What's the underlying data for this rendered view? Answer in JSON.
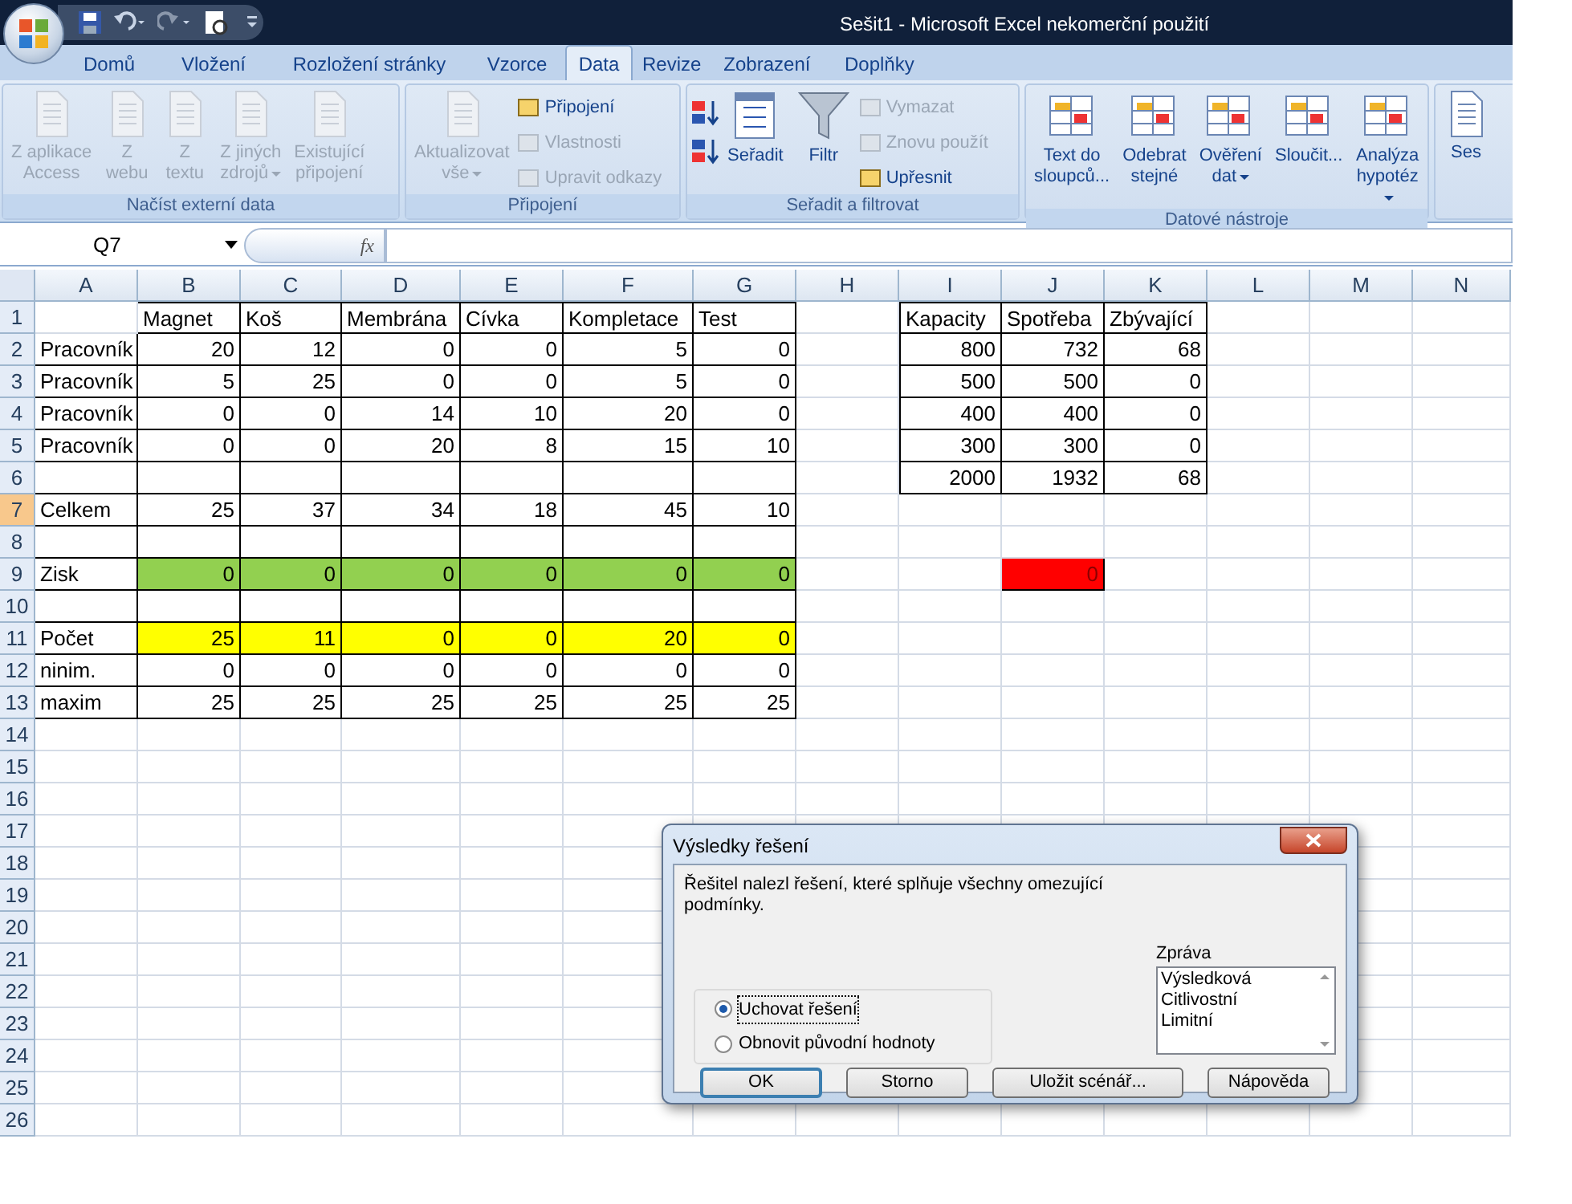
{
  "window": {
    "title": "Sešit1 - Microsoft Excel nekomerční použití"
  },
  "tabs": [
    {
      "label": "Domů",
      "selected": false
    },
    {
      "label": "Vložení",
      "selected": false
    },
    {
      "label": "Rozložení stránky",
      "selected": false
    },
    {
      "label": "Vzorce",
      "selected": false
    },
    {
      "label": "Data",
      "selected": true
    },
    {
      "label": "Revize",
      "selected": false
    },
    {
      "label": "Zobrazení",
      "selected": false
    },
    {
      "label": "Doplňky",
      "selected": false
    }
  ],
  "ribbon_groups": [
    {
      "label": "Načíst externí data",
      "items": [
        {
          "kind": "large",
          "label": "Z aplikace\nAccess",
          "disabled": true
        },
        {
          "kind": "large",
          "label": "Z\nwebu",
          "disabled": true
        },
        {
          "kind": "large",
          "label": "Z\ntextu",
          "disabled": true
        },
        {
          "kind": "large",
          "label": "Z jiných\nzdrojů",
          "dropdown": true,
          "disabled": true
        },
        {
          "kind": "large",
          "label": "Existující\npřipojení",
          "disabled": true
        }
      ]
    },
    {
      "label": "Připojení",
      "items": [
        {
          "kind": "large",
          "label": "Aktualizovat\nvše",
          "dropdown": true,
          "disabled": true
        },
        {
          "kind": "small",
          "label": "Připojení",
          "disabled": false
        },
        {
          "kind": "small",
          "label": "Vlastnosti",
          "disabled": true
        },
        {
          "kind": "small",
          "label": "Upravit odkazy",
          "disabled": true
        }
      ]
    },
    {
      "label": "Seřadit a filtrovat",
      "items": [
        {
          "kind": "sort",
          "label": "Seřadit",
          "disabled": false
        },
        {
          "kind": "large",
          "label": "Filtr",
          "disabled": false
        },
        {
          "kind": "small",
          "label": "Vymazat",
          "disabled": true
        },
        {
          "kind": "small",
          "label": "Znovu použít",
          "disabled": true
        },
        {
          "kind": "small",
          "label": "Upřesnit",
          "disabled": false
        }
      ]
    },
    {
      "label": "Datové nástroje",
      "items": [
        {
          "kind": "large",
          "label": "Text do\nsloupců...",
          "disabled": false
        },
        {
          "kind": "large",
          "label": "Odebrat\nstejné",
          "disabled": false
        },
        {
          "kind": "large",
          "label": "Ověření\ndat",
          "dropdown": true,
          "disabled": false
        },
        {
          "kind": "large",
          "label": "Sloučit...",
          "disabled": false
        },
        {
          "kind": "large",
          "label": "Analýza\nhypotéz",
          "dropdown": true,
          "disabled": false
        }
      ]
    },
    {
      "items": [
        {
          "kind": "large",
          "label": "Ses",
          "disabled": false
        }
      ]
    }
  ],
  "name_box": "Q7",
  "formula_label": "fx",
  "columns": [
    "A",
    "B",
    "C",
    "D",
    "E",
    "F",
    "G",
    "H",
    "I",
    "J",
    "K",
    "L",
    "M",
    "N"
  ],
  "rows": [
    {
      "number": "1",
      "selected": false,
      "cells": [
        null,
        "Magnet",
        "Koš",
        "Membrána",
        "Cívka",
        "Kompletace",
        "Test",
        null,
        "Kapacity",
        "Spotřeba",
        "Zbývající"
      ]
    },
    {
      "number": "2",
      "selected": false,
      "cells": [
        "Pracovník",
        "20",
        "12",
        "0",
        "0",
        "5",
        "0",
        null,
        "800",
        "732",
        "68"
      ]
    },
    {
      "number": "3",
      "selected": false,
      "cells": [
        "Pracovník",
        "5",
        "25",
        "0",
        "0",
        "5",
        "0",
        null,
        "500",
        "500",
        "0"
      ]
    },
    {
      "number": "4",
      "selected": false,
      "cells": [
        "Pracovník",
        "0",
        "0",
        "14",
        "10",
        "20",
        "0",
        null,
        "400",
        "400",
        "0"
      ]
    },
    {
      "number": "5",
      "selected": false,
      "cells": [
        "Pracovník",
        "0",
        "0",
        "20",
        "8",
        "15",
        "10",
        null,
        "300",
        "300",
        "0"
      ]
    },
    {
      "number": "6",
      "selected": false,
      "cells": [
        null,
        null,
        null,
        null,
        null,
        null,
        null,
        null,
        "2000",
        "1932",
        "68"
      ]
    },
    {
      "number": "7",
      "selected": true,
      "cells": [
        "Celkem",
        "25",
        "37",
        "34",
        "18",
        "45",
        "10"
      ]
    },
    {
      "number": "8",
      "selected": false
    },
    {
      "number": "9",
      "selected": false,
      "cells": [
        "Zisk",
        {
          "text": "0",
          "color": "#92d050"
        },
        {
          "text": "0",
          "color": "#92d050"
        },
        {
          "text": "0",
          "color": "#92d050"
        },
        {
          "text": "0",
          "color": "#92d050"
        },
        {
          "text": "0",
          "color": "#92d050"
        },
        {
          "text": "0",
          "color": "#92d050"
        },
        null,
        null,
        {
          "text": "0",
          "color": "#ff0000"
        }
      ]
    },
    {
      "number": "10",
      "selected": false
    },
    {
      "number": "11",
      "selected": false,
      "cells": [
        "Počet",
        {
          "text": "25",
          "color": "#ffff00"
        },
        {
          "text": "11",
          "color": "#ffff00"
        },
        {
          "text": "0",
          "color": "#ffff00"
        },
        {
          "text": "0",
          "color": "#ffff00"
        },
        {
          "text": "20",
          "color": "#ffff00"
        },
        {
          "text": "0",
          "color": "#ffff00"
        }
      ]
    },
    {
      "number": "12",
      "selected": false,
      "cells": [
        "ninim.",
        "0",
        "0",
        "0",
        "0",
        "0",
        "0"
      ]
    },
    {
      "number": "13",
      "selected": false,
      "cells": [
        "maxim",
        "25",
        "25",
        "25",
        "25",
        "25",
        "25"
      ]
    },
    {
      "number": "14",
      "selected": false
    },
    {
      "number": "15",
      "selected": false
    },
    {
      "number": "16",
      "selected": false
    },
    {
      "number": "17",
      "selected": false
    },
    {
      "number": "18",
      "selected": false
    },
    {
      "number": "19",
      "selected": false
    },
    {
      "number": "20",
      "selected": false
    },
    {
      "number": "21",
      "selected": false
    },
    {
      "number": "22",
      "selected": false
    },
    {
      "number": "23",
      "selected": false
    },
    {
      "number": "24",
      "selected": false
    },
    {
      "number": "25",
      "selected": false
    },
    {
      "number": "26",
      "selected": false
    }
  ],
  "dialog": {
    "title": "Výsledky řešení",
    "message": "Řešitel nalezl řešení, které splňuje všechny omezující podmínky.",
    "options": [
      {
        "label": "Uchovat řešení",
        "selected": true
      },
      {
        "label": "Obnovit původní hodnoty",
        "selected": false
      }
    ],
    "report_label": "Zpráva",
    "reports": [
      "Výsledková",
      "Citlivostní",
      "Limitní"
    ],
    "buttons": [
      {
        "label": "OK",
        "default": true
      },
      {
        "label": "Storno",
        "default": false
      },
      {
        "label": "Uložit scénář...",
        "default": false
      },
      {
        "label": "Nápověda",
        "default": false
      }
    ]
  }
}
